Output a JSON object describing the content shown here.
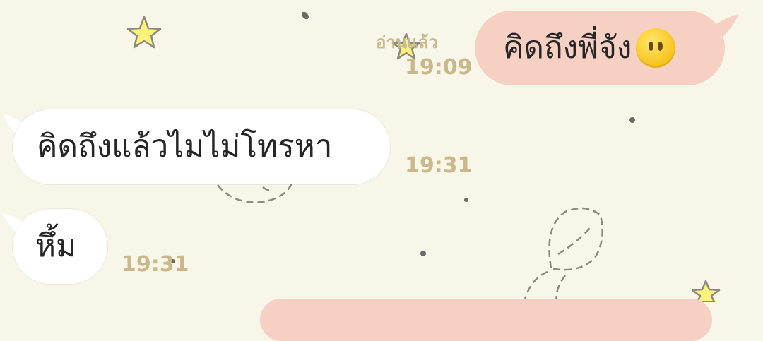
{
  "messages": [
    {
      "side": "outgoing",
      "text": "คิดถึงพี่จัง",
      "emoji": "neutral-face-icon",
      "read_label": "อ่านแล้ว",
      "time": "19:09"
    },
    {
      "side": "incoming",
      "text": "คิดถึงแล้วไมไม่โทรหา",
      "time": "19:31"
    },
    {
      "side": "incoming",
      "text": "หึ้ม",
      "time": "19:31"
    }
  ],
  "colors": {
    "background": "#f8f6e8",
    "outgoing_bubble": "#f6d0c2",
    "incoming_bubble": "#ffffff",
    "meta_text": "#c9b98a"
  }
}
